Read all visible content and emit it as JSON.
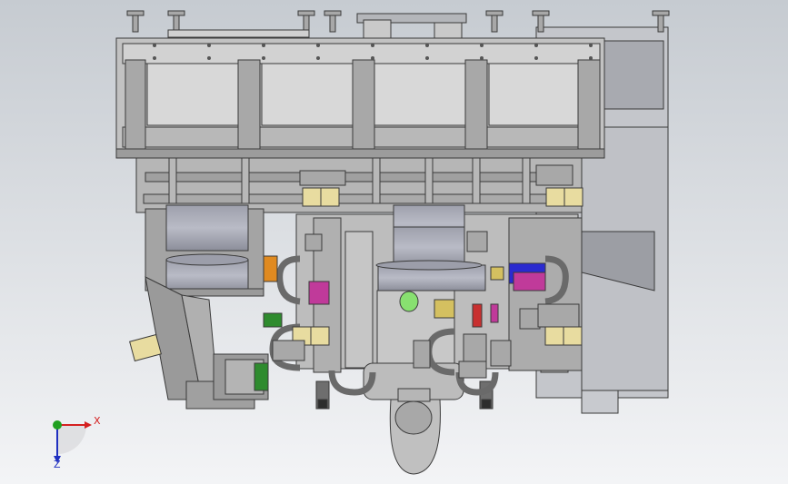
{
  "viewport": {
    "background_top": "#c6cbd1",
    "background_bottom": "#f3f4f6",
    "model_face": "#bcbcbc",
    "model_edge": "#3a3a3a",
    "accent_colors": {
      "yellow_solenoid": "#e8dca0",
      "magenta_part": "#c03a9a",
      "green_part": "#2e8b2e",
      "blue_part": "#2a2ad0",
      "orange_part": "#e08a20",
      "red_part": "#c83030",
      "green_light": "#88e070"
    }
  },
  "triad": {
    "x_label": "X",
    "z_label": "Z",
    "x_color": "#d42020",
    "y_color": "#20a020",
    "z_color": "#2030c0"
  }
}
